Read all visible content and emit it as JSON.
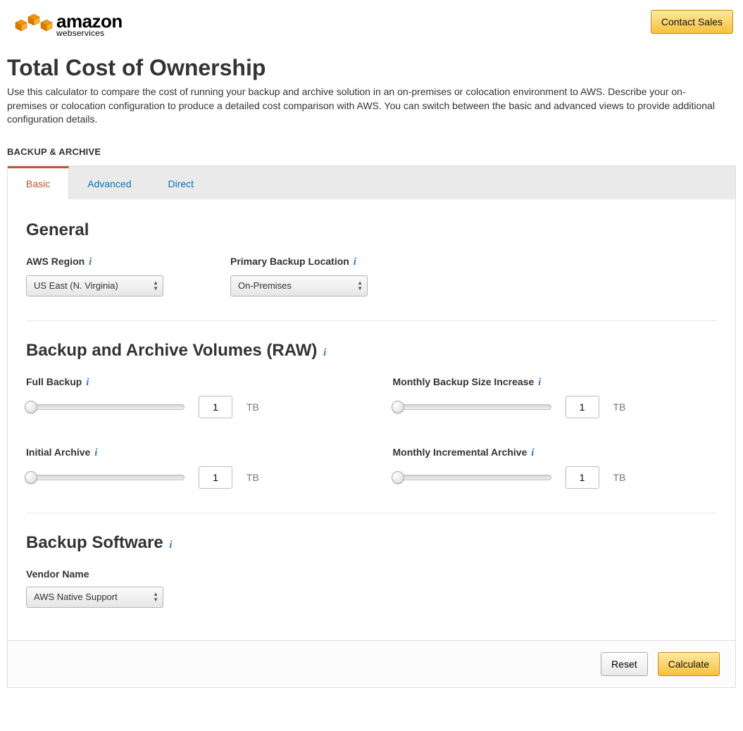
{
  "header": {
    "contact_sales": "Contact Sales",
    "logo_main": "amazon",
    "logo_sub": "webservices"
  },
  "page": {
    "title": "Total Cost of Ownership",
    "description": "Use this calculator to compare the cost of running your backup and archive solution in an on-premises or colocation environment to AWS. Describe your on-premises or colocation configuration to produce a detailed cost comparison with AWS. You can switch between the basic and advanced views to provide additional configuration details.",
    "section_label": "BACKUP & ARCHIVE"
  },
  "tabs": {
    "basic": "Basic",
    "advanced": "Advanced",
    "direct": "Direct"
  },
  "general": {
    "heading": "General",
    "region_label": "AWS Region",
    "region_value": "US East (N. Virginia)",
    "location_label": "Primary Backup Location",
    "location_value": "On-Premises"
  },
  "volumes": {
    "heading": "Backup and Archive Volumes (RAW)",
    "unit": "TB",
    "full_backup_label": "Full Backup",
    "full_backup_value": "1",
    "monthly_backup_label": "Monthly Backup Size Increase",
    "monthly_backup_value": "1",
    "initial_archive_label": "Initial Archive",
    "initial_archive_value": "1",
    "monthly_archive_label": "Monthly Incremental Archive",
    "monthly_archive_value": "1"
  },
  "software": {
    "heading": "Backup Software",
    "vendor_label": "Vendor Name",
    "vendor_value": "AWS Native Support"
  },
  "footer": {
    "reset": "Reset",
    "calculate": "Calculate"
  }
}
